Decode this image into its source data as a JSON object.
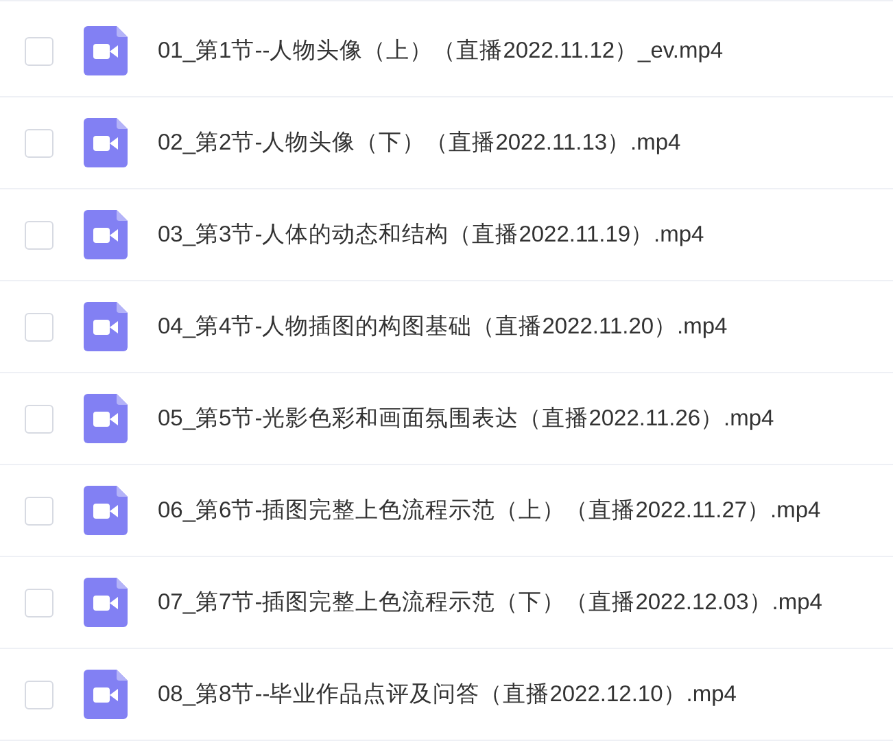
{
  "files": [
    {
      "name": "01_第1节--人物头像（上）（直播2022.11.12）_ev.mp4",
      "checked": false
    },
    {
      "name": "02_第2节-人物头像（下）（直播2022.11.13）.mp4",
      "checked": false
    },
    {
      "name": "03_第3节-人体的动态和结构（直播2022.11.19）.mp4",
      "checked": false
    },
    {
      "name": "04_第4节-人物插图的构图基础（直播2022.11.20）.mp4",
      "checked": false
    },
    {
      "name": "05_第5节-光影色彩和画面氛围表达（直播2022.11.26）.mp4",
      "checked": false
    },
    {
      "name": "06_第6节-插图完整上色流程示范（上）（直播2022.11.27）.mp4",
      "checked": false
    },
    {
      "name": "07_第7节-插图完整上色流程示范（下）（直播2022.12.03）.mp4",
      "checked": false
    },
    {
      "name": "08_第8节--毕业作品点评及问答（直播2022.12.10）.mp4",
      "checked": false
    }
  ]
}
